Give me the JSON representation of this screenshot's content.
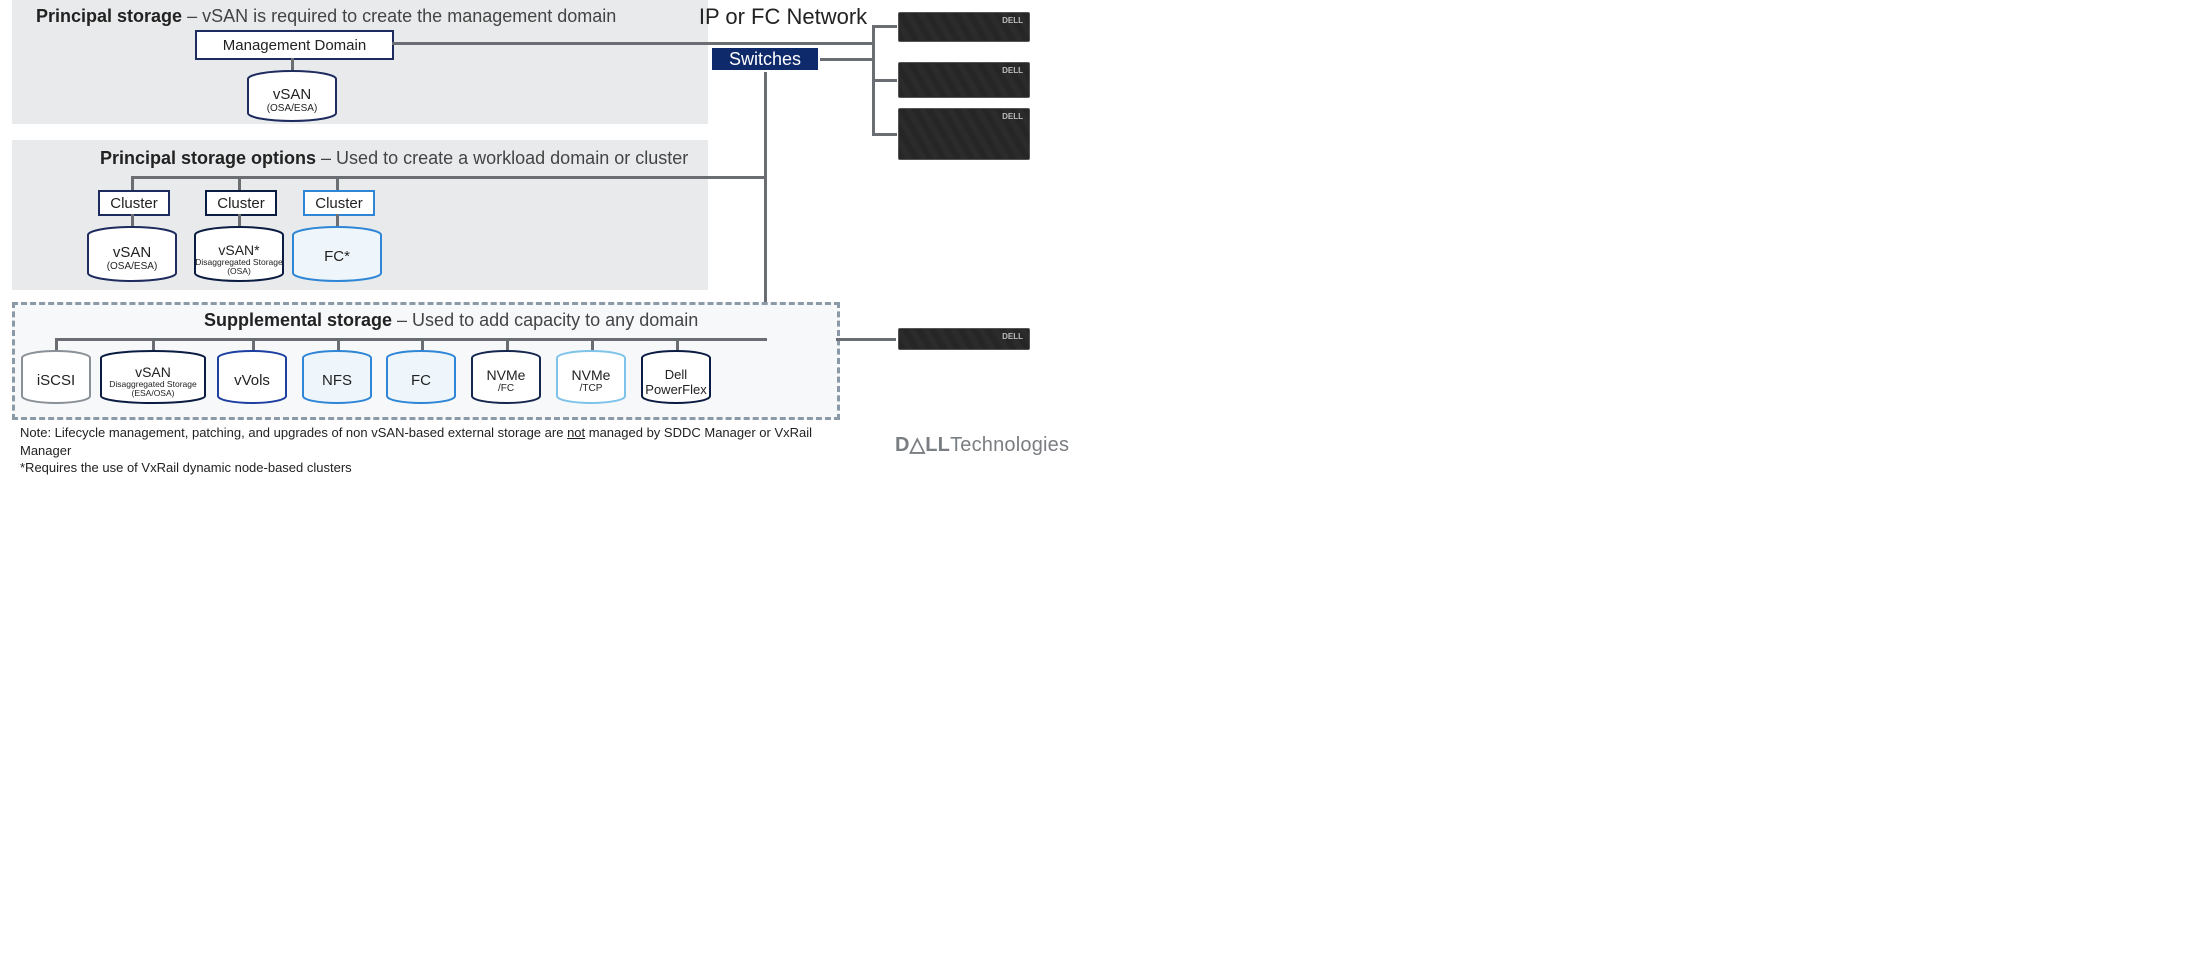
{
  "panel1": {
    "title_bold": "Principal storage",
    "title_rest": " – vSAN is required to create the management domain",
    "mgmt_domain": "Management Domain",
    "cyl_vsan_l1": "vSAN",
    "cyl_vsan_l2": "(OSA/ESA)"
  },
  "network": {
    "label": "IP or FC Network",
    "switches": "Switches"
  },
  "panel2": {
    "title_bold": "Principal storage options",
    "title_rest": " – Used to create a workload domain or cluster",
    "cluster": "Cluster",
    "cyl1_l1": "vSAN",
    "cyl1_l2": "(OSA/ESA)",
    "cyl2_l1": "vSAN*",
    "cyl2_l2": "Disaggregated Storage (OSA)",
    "cyl3_l1": "FC*"
  },
  "panel3": {
    "title_bold": "Supplemental storage",
    "title_rest": " – Used to add capacity to any domain",
    "c1": "iSCSI",
    "c2_l1": "vSAN",
    "c2_l2": "Disaggregated Storage (ESA/OSA)",
    "c3": "vVols",
    "c4": "NFS",
    "c5": "FC",
    "c6_l1": "NVMe",
    "c6_l2": "/FC",
    "c7_l1": "NVMe",
    "c7_l2": "/TCP",
    "c8_l1": "Dell",
    "c8_l2": "PowerFlex"
  },
  "footer": {
    "note1a": "Note: Lifecycle management, patching, and upgrades of non vSAN-based external storage are ",
    "note1b": "not",
    "note1c": " managed by SDDC Manager or VxRail Manager",
    "note2": "*Requires the use of VxRail dynamic node-based clusters",
    "logo": "Technologies",
    "logo_d": "D△LL"
  },
  "hw": {
    "brand": "DELL"
  }
}
